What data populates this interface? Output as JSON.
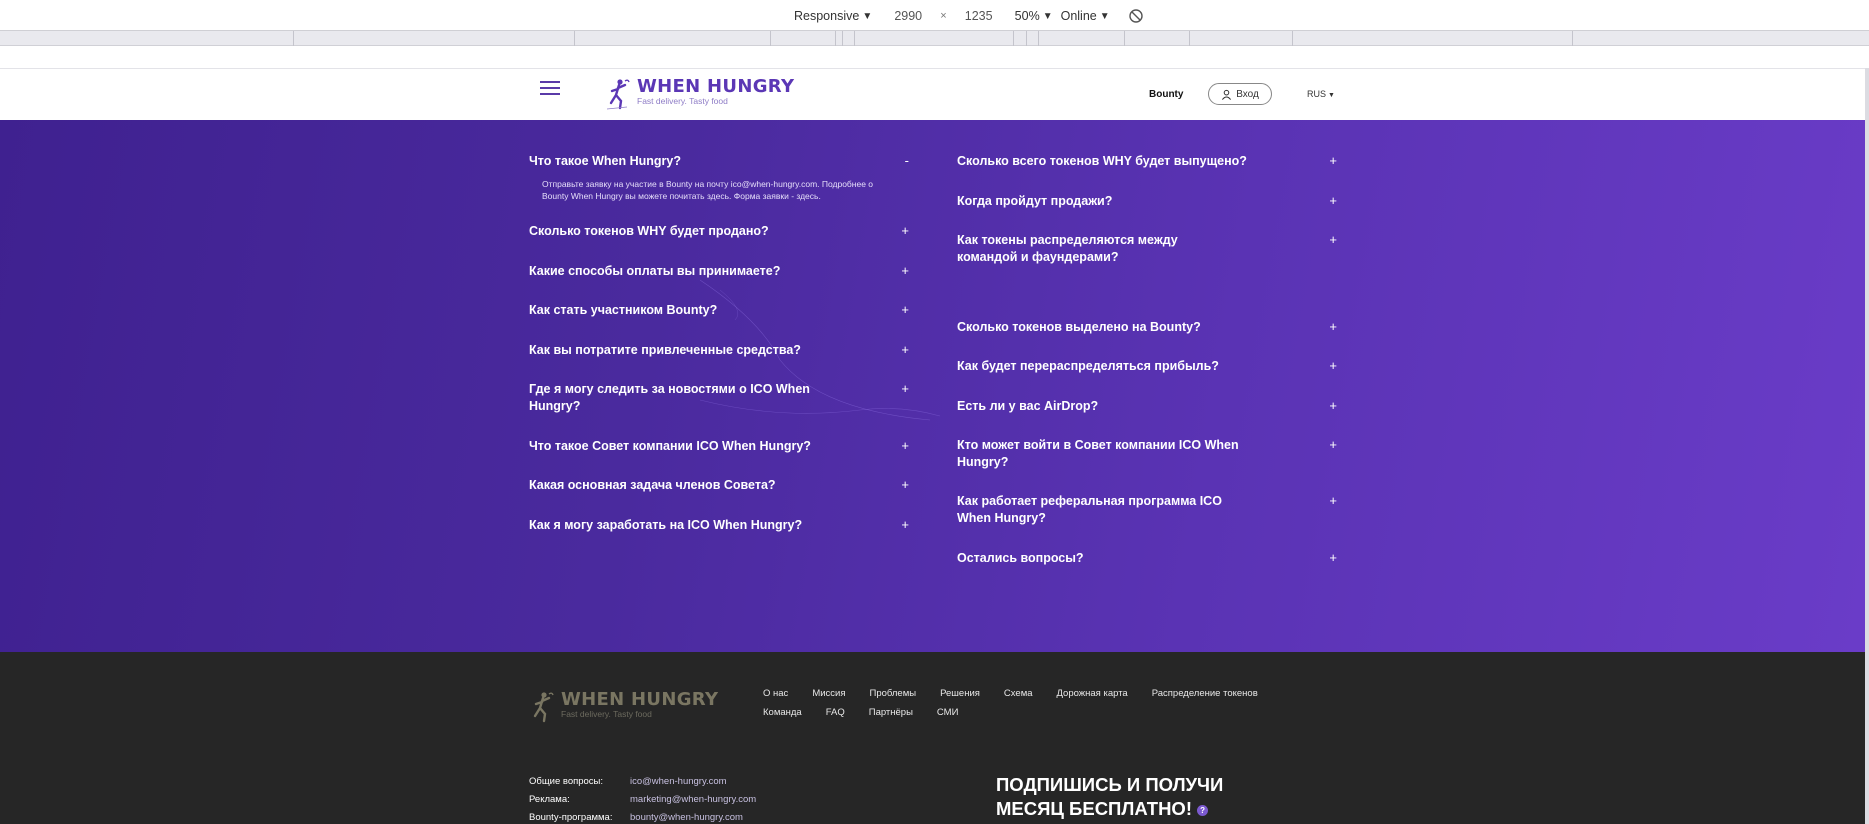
{
  "devtools": {
    "device": "Responsive",
    "width": "2990",
    "times": "×",
    "height": "1235",
    "zoom": "50%",
    "network": "Online",
    "caret": "▼"
  },
  "header": {
    "logo_title": "WHEN HUNGRY",
    "logo_sub": "Fast delivery. Tasty food",
    "nav_bounty": "Bounty",
    "login_label": "Вход",
    "lang": "RUS",
    "lang_caret": "▼"
  },
  "faq": {
    "left": [
      {
        "q": "Что такое When Hungry?",
        "toggle": "-",
        "a": "Отправьте заявку на участие в Bounty на почту ico@when-hungry.com. Подробнее о Bounty When Hungry вы можете почитать здесь. Форма заявки - здесь."
      },
      {
        "q": "Сколько токенов WHY будет продано?",
        "toggle": "+"
      },
      {
        "q": "Какие способы оплаты вы принимаете?",
        "toggle": "+"
      },
      {
        "q": "Как стать участником Bounty?",
        "toggle": "+"
      },
      {
        "q": "Как вы потратите привлеченные средства?",
        "toggle": "+"
      },
      {
        "q": "Где я могу следить за новостями о ICO When Hungry?",
        "toggle": "+"
      },
      {
        "q": "Что такое Совет компании ICO When Hungry?",
        "toggle": "+"
      },
      {
        "q": "Какая основная задача членов Совета?",
        "toggle": "+"
      },
      {
        "q": "Как я могу заработать на ICO When Hungry?",
        "toggle": "+"
      }
    ],
    "right": [
      {
        "q": "Сколько всего токенов WHY будет выпущено?",
        "toggle": "+"
      },
      {
        "q": "Когда пройдут продажи?",
        "toggle": "+"
      },
      {
        "q": "Как токены распределяются между командой и фаундерами?",
        "toggle": "+"
      },
      {
        "q": "Сколько токенов выделено на Bounty?",
        "toggle": "+"
      },
      {
        "q": "Как будет перераспределяться прибыль?",
        "toggle": "+"
      },
      {
        "q": "Есть ли у вас AirDrop?",
        "toggle": "+"
      },
      {
        "q": "Кто может войти в Совет компании ICO When Hungry?",
        "toggle": "+"
      },
      {
        "q": "Как работает реферальная программа ICO When Hungry?",
        "toggle": "+"
      },
      {
        "q": "Остались вопросы?",
        "toggle": "+"
      }
    ]
  },
  "footer": {
    "logo_title": "WHEN HUNGRY",
    "logo_sub": "Fast delivery. Tasty food",
    "nav_row1": [
      "О нас",
      "Миссия",
      "Проблемы",
      "Решения",
      "Схема",
      "Дорожная карта",
      "Распределение токенов"
    ],
    "nav_row2": [
      "Команда",
      "FAQ",
      "Партнёры",
      "СМИ"
    ],
    "contacts": [
      {
        "label": "Общие вопросы:",
        "email": "ico@when-hungry.com"
      },
      {
        "label": "Реклама:",
        "email": "marketing@when-hungry.com"
      },
      {
        "label": "Bounty-программа:",
        "email": "bounty@when-hungry.com"
      }
    ],
    "subscribe_line1": "ПОДПИШИСЬ И ПОЛУЧИ",
    "subscribe_line2": "МЕСЯЦ БЕСПЛАТНО!",
    "q_mark": "?"
  },
  "colors": {
    "brand": "#5b37b5",
    "faq_bg_start": "#3f2190",
    "faq_bg_end": "#6a3cc8",
    "footer_bg": "#262626"
  }
}
